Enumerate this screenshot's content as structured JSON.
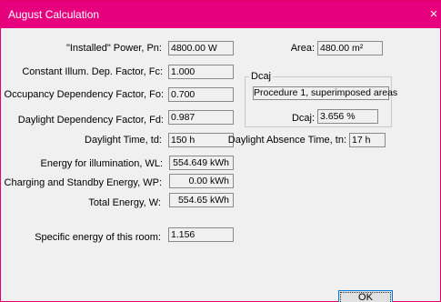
{
  "window": {
    "title": "August Calculation",
    "close_glyph": "×",
    "title_color": "#e6007e"
  },
  "fields": {
    "installed_power": {
      "label": "\"Installed\" Power, Pn:",
      "value": "4800.00 W"
    },
    "constant_illum": {
      "label": "Constant Illum. Dep. Factor, Fc:",
      "value": "1.000"
    },
    "occupancy": {
      "label": "Occupancy Dependency Factor, Fo:",
      "value": "0.700"
    },
    "daylight_dep": {
      "label": "Daylight Dependency Factor, Fd:",
      "value": "0.987"
    },
    "daylight_time": {
      "label": "Daylight Time, td:",
      "value": "150 h"
    },
    "energy_illum": {
      "label": "Energy  for illumination, WL:",
      "value": "554.649 kWh"
    },
    "charging_standby": {
      "label": "Charging and Standby Energy, WP:",
      "value": "0.00 kWh"
    },
    "total_energy": {
      "label": "Total Energy, W:",
      "value": "554.65 kWh"
    },
    "specific_energy": {
      "label": "Specific energy of this room:",
      "value": "1.156"
    },
    "area": {
      "label": "Area:",
      "value": "480.00 m²"
    },
    "daylight_absence": {
      "label": "Daylight Absence Time, tn:",
      "value": "17 h"
    }
  },
  "dcaj": {
    "group_title": "Dcaj",
    "procedure": "Procedure 1, superimposed areas",
    "label": "Dcaj:",
    "value": "3.656 %"
  },
  "buttons": {
    "ok": "OK"
  }
}
